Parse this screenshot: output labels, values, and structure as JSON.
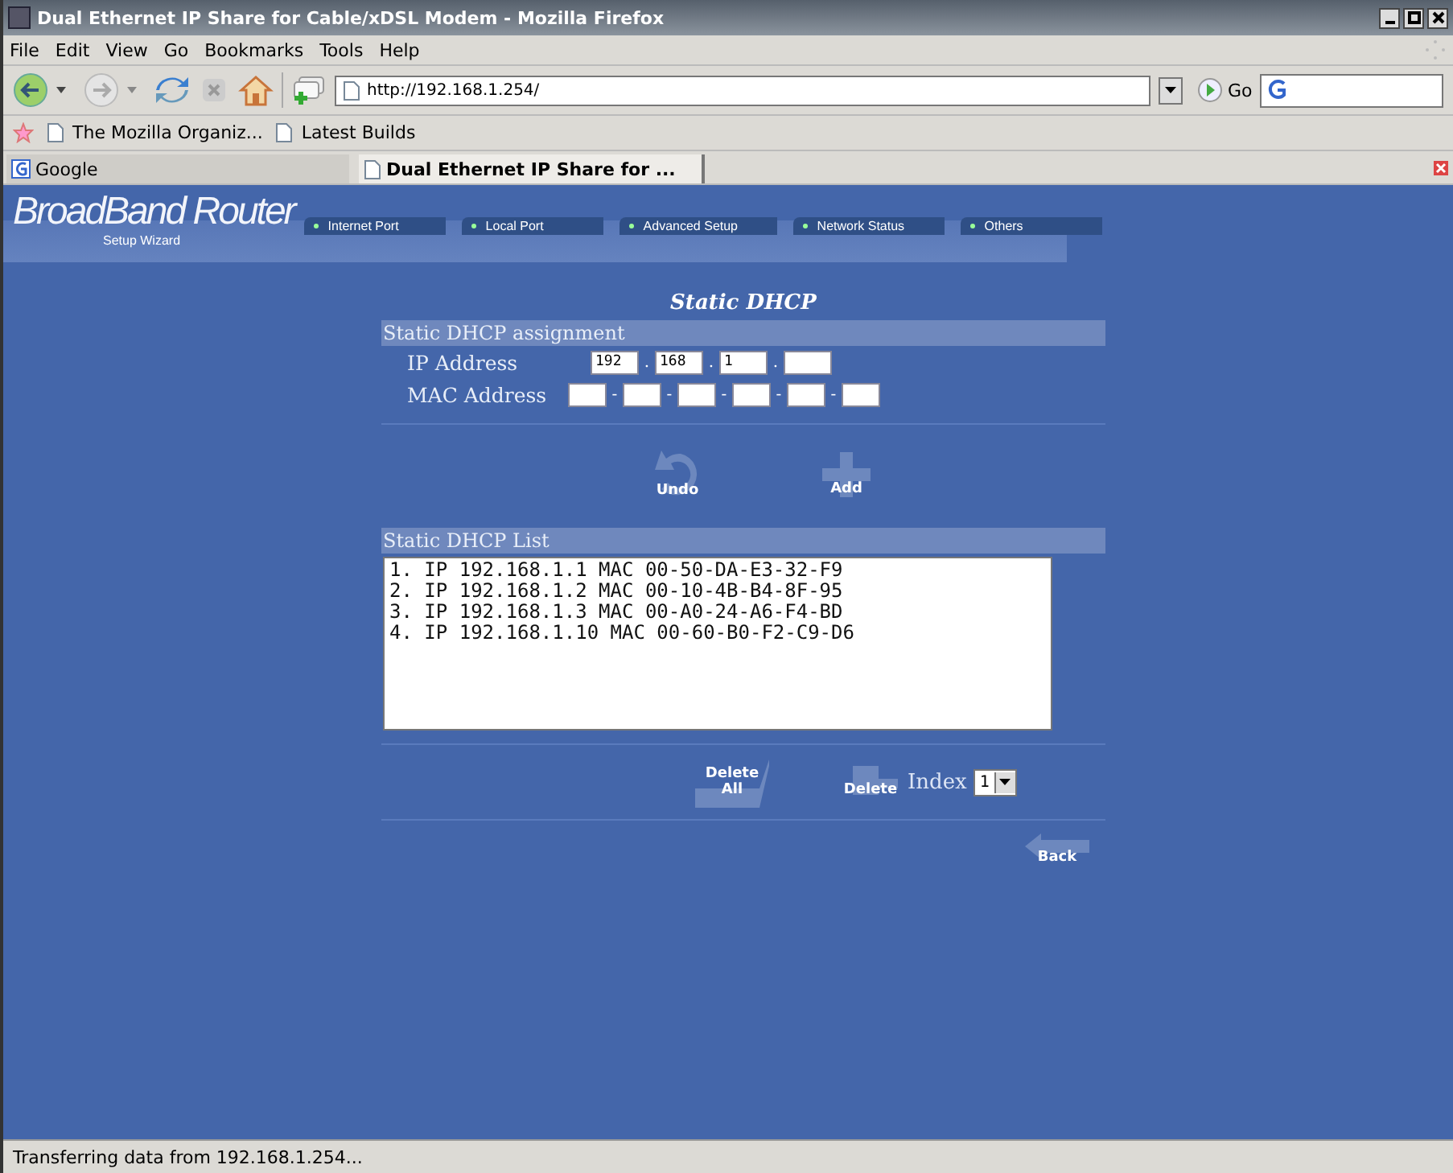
{
  "window": {
    "title": "Dual Ethernet IP Share for Cable/xDSL Modem - Mozilla Firefox"
  },
  "menu": [
    "File",
    "Edit",
    "View",
    "Go",
    "Bookmarks",
    "Tools",
    "Help"
  ],
  "address_bar": {
    "value": "http://192.168.1.254/",
    "go_label": "Go"
  },
  "bookmarks": [
    "The Mozilla Organiz...",
    "Latest Builds"
  ],
  "tabs": [
    {
      "label": "Google",
      "selected": false
    },
    {
      "label": "Dual Ethernet IP Share for ...",
      "selected": true
    }
  ],
  "router": {
    "logo": "BroadBand Router",
    "setup_wizard": "Setup Wizard",
    "nav": [
      "Internet Port",
      "Local Port",
      "Advanced Setup",
      "Network Status",
      "Others"
    ],
    "page_title": "Static DHCP",
    "assignment": {
      "heading": "Static DHCP assignment",
      "ip_label": "IP Address",
      "ip_values": [
        "192",
        "168",
        "1"
      ],
      "ip_separators": [
        ".",
        ".",
        "."
      ],
      "mac_label": "MAC Address",
      "mac_separators": [
        "-",
        "-",
        "-",
        "-",
        "-"
      ]
    },
    "undo_label": "Undo",
    "add_label": "Add",
    "list": {
      "heading": "Static DHCP List",
      "entries": [
        "1. IP 192.168.1.1 MAC 00-50-DA-E3-32-F9",
        "2. IP 192.168.1.2 MAC 00-10-4B-B4-8F-95",
        "3. IP 192.168.1.3 MAC 00-A0-24-A6-F4-BD",
        "4. IP 192.168.1.10 MAC 00-60-B0-F2-C9-D6"
      ]
    },
    "delete_all_label": [
      "Delete",
      "All"
    ],
    "delete_label": "Delete",
    "index_label": "Index",
    "index_value": "1",
    "back_label": "Back"
  },
  "status_bar": "Transferring data from 192.168.1.254..."
}
